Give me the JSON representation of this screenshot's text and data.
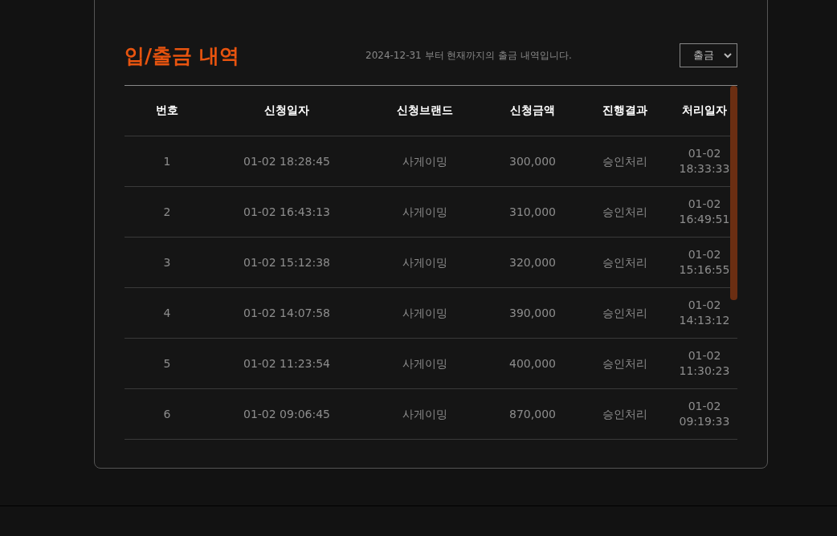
{
  "title": "입/출금 내역",
  "notice": "2024-12-31 부터 현재까지의 출금 내역입니다.",
  "filter": {
    "value": "출금"
  },
  "table": {
    "columns": [
      "번호",
      "신청일자",
      "신청브랜드",
      "신청금액",
      "진행결과",
      "처리일자"
    ],
    "rows": [
      [
        "1",
        "01-02 18:28:45",
        "사게이밍",
        "300,000",
        "승인처리",
        "01-02 18:33:33"
      ],
      [
        "2",
        "01-02 16:43:13",
        "사게이밍",
        "310,000",
        "승인처리",
        "01-02 16:49:51"
      ],
      [
        "3",
        "01-02 15:12:38",
        "사게이밍",
        "320,000",
        "승인처리",
        "01-02 15:16:55"
      ],
      [
        "4",
        "01-02 14:07:58",
        "사게이밍",
        "390,000",
        "승인처리",
        "01-02 14:13:12"
      ],
      [
        "5",
        "01-02 11:23:54",
        "사게이밍",
        "400,000",
        "승인처리",
        "01-02 11:30:23"
      ],
      [
        "6",
        "01-02 09:06:45",
        "사게이밍",
        "870,000",
        "승인처리",
        "01-02 09:19:33"
      ]
    ]
  }
}
